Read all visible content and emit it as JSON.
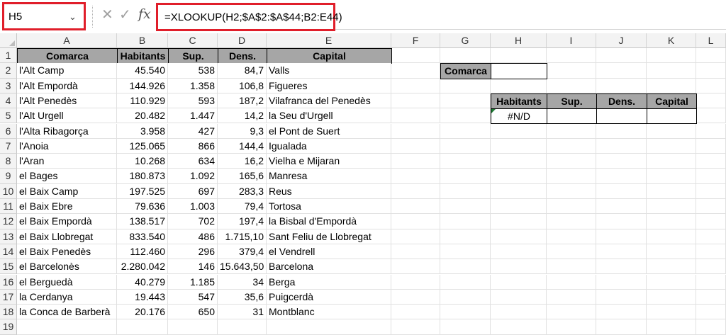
{
  "name_box": {
    "ref": "H5"
  },
  "formula": "=XLOOKUP(H2;$A$2:$A$44;B2:E44)",
  "columns": [
    "A",
    "B",
    "C",
    "D",
    "E",
    "F",
    "G",
    "H",
    "I",
    "J",
    "K",
    "L"
  ],
  "table": {
    "headers": [
      "Comarca",
      "Habitants",
      "Sup.",
      "Dens.",
      "Capital"
    ],
    "rows": [
      [
        "l'Alt Camp",
        "45.540",
        "538",
        "84,7",
        "Valls"
      ],
      [
        "l'Alt Empordà",
        "144.926",
        "1.358",
        "106,8",
        "Figueres"
      ],
      [
        "l'Alt Penedès",
        "110.929",
        "593",
        "187,2",
        "Vilafranca del Penedès"
      ],
      [
        "l'Alt Urgell",
        "20.482",
        "1.447",
        "14,2",
        "la Seu d'Urgell"
      ],
      [
        "l'Alta Ribagorça",
        "3.958",
        "427",
        "9,3",
        "el Pont de Suert"
      ],
      [
        "l'Anoia",
        "125.065",
        "866",
        "144,4",
        "Igualada"
      ],
      [
        "l'Aran",
        "10.268",
        "634",
        "16,2",
        "Vielha e Mijaran"
      ],
      [
        "el Bages",
        "180.873",
        "1.092",
        "165,6",
        "Manresa"
      ],
      [
        "el Baix Camp",
        "197.525",
        "697",
        "283,3",
        "Reus"
      ],
      [
        "el Baix Ebre",
        "79.636",
        "1.003",
        "79,4",
        "Tortosa"
      ],
      [
        "el Baix Empordà",
        "138.517",
        "702",
        "197,4",
        "la Bisbal d'Empordà"
      ],
      [
        "el Baix Llobregat",
        "833.540",
        "486",
        "1.715,10",
        "Sant Feliu de Llobregat"
      ],
      [
        "el Baix Penedès",
        "112.460",
        "296",
        "379,4",
        "el Vendrell"
      ],
      [
        "el Barcelonès",
        "2.280.042",
        "146",
        "15.643,50",
        "Barcelona"
      ],
      [
        "el Berguedà",
        "40.279",
        "1.185",
        "34",
        "Berga"
      ],
      [
        "la Cerdanya",
        "19.443",
        "547",
        "35,6",
        "Puigcerdà"
      ],
      [
        "la Conca de Barberà",
        "20.176",
        "650",
        "31",
        "Montblanc"
      ]
    ]
  },
  "lookup": {
    "label": "Comarca",
    "input_value": "",
    "result_headers": [
      "Habitants",
      "Sup.",
      "Dens.",
      "Capital"
    ],
    "result_values": [
      "#N/D",
      "",
      "",
      ""
    ]
  },
  "colors": {
    "highlight": "#e01e2a",
    "header_fill": "#a6a6a6",
    "error_marker": "#1e7b34"
  }
}
